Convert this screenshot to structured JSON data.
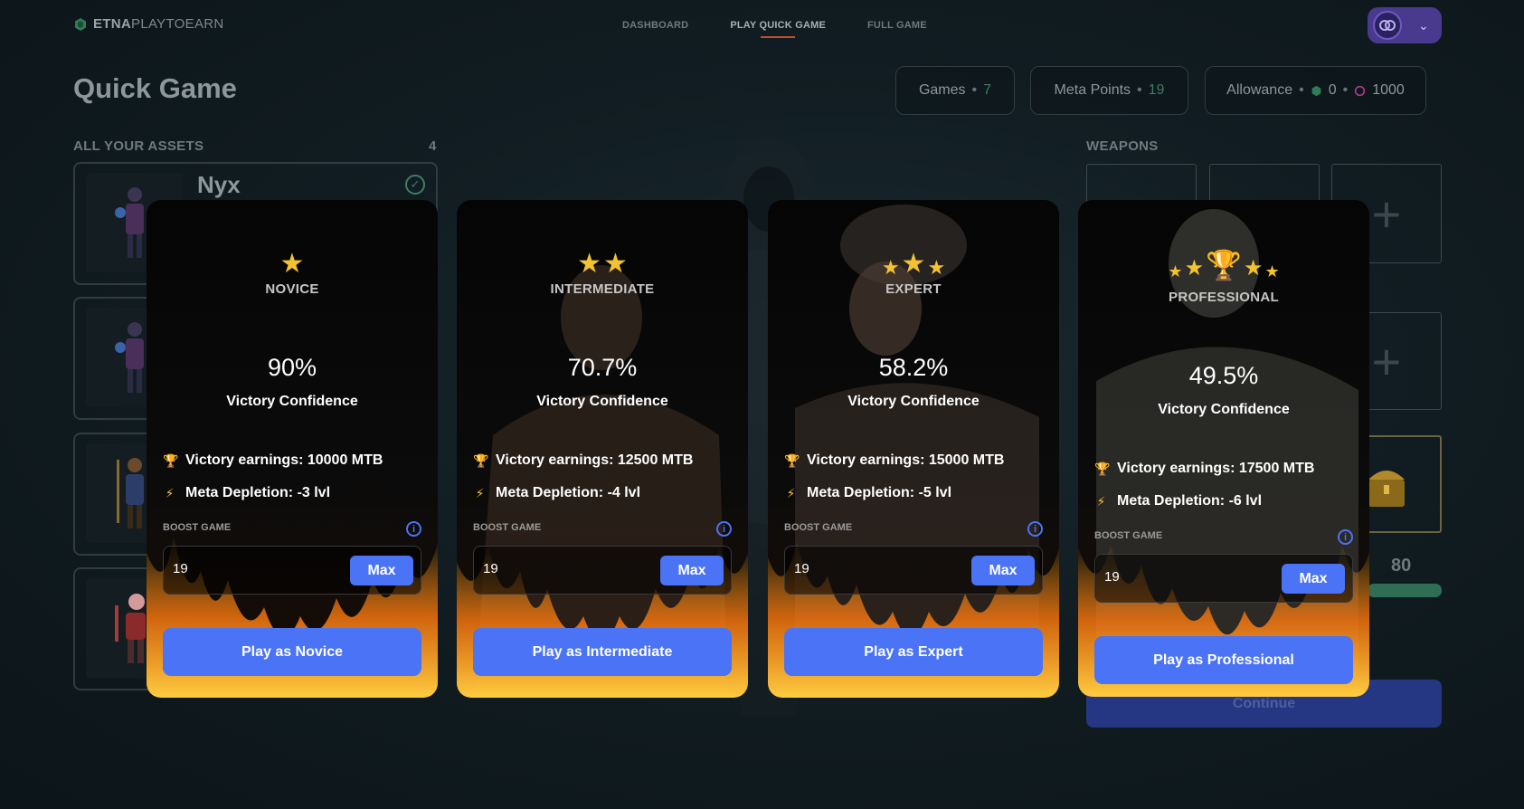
{
  "nav": {
    "logo_bold": "ETNA",
    "logo_light": "PLAYTOEARN",
    "items": [
      {
        "label": "DASHBOARD"
      },
      {
        "label": "PLAY QUICK GAME"
      },
      {
        "label": "FULL GAME"
      }
    ]
  },
  "header": {
    "title": "Quick Game",
    "games_label": "Games",
    "games_value": "7",
    "meta_label": "Meta Points",
    "meta_value": "19",
    "allowance_label": "Allowance",
    "allowance_value_1": "0",
    "allowance_value_2": "1000"
  },
  "assets": {
    "label": "ALL YOUR ASSETS",
    "count": "4",
    "first_name": "Nyx"
  },
  "weapons": {
    "label": "WEAPONS",
    "stat_value": "80",
    "continue_label": "Continue"
  },
  "cards": [
    {
      "level": "NOVICE",
      "pct": "90%",
      "confidence": "Victory Confidence",
      "earnings": "Victory earnings: 10000 MTB",
      "depletion": "Meta Depletion: -3 lvl",
      "boost_label": "BOOST GAME",
      "boost_value": "19",
      "max_label": "Max",
      "play_label": "Play as Novice"
    },
    {
      "level": "INTERMEDIATE",
      "pct": "70.7%",
      "confidence": "Victory Confidence",
      "earnings": "Victory earnings: 12500 MTB",
      "depletion": "Meta Depletion: -4 lvl",
      "boost_label": "BOOST GAME",
      "boost_value": "19",
      "max_label": "Max",
      "play_label": "Play as Intermediate"
    },
    {
      "level": "EXPERT",
      "pct": "58.2%",
      "confidence": "Victory Confidence",
      "earnings": "Victory earnings: 15000 MTB",
      "depletion": "Meta Depletion: -5 lvl",
      "boost_label": "BOOST GAME",
      "boost_value": "19",
      "max_label": "Max",
      "play_label": "Play as Expert"
    },
    {
      "level": "PROFESSIONAL",
      "pct": "49.5%",
      "confidence": "Victory Confidence",
      "earnings": "Victory earnings: 17500 MTB",
      "depletion": "Meta Depletion: -6 lvl",
      "boost_label": "BOOST GAME",
      "boost_value": "19",
      "max_label": "Max",
      "play_label": "Play as Professional"
    }
  ],
  "colors": {
    "accent": "#4a73f5",
    "star": "#f2c230",
    "positive": "#3f7d63",
    "nav_active_underline": "#c0502b"
  }
}
